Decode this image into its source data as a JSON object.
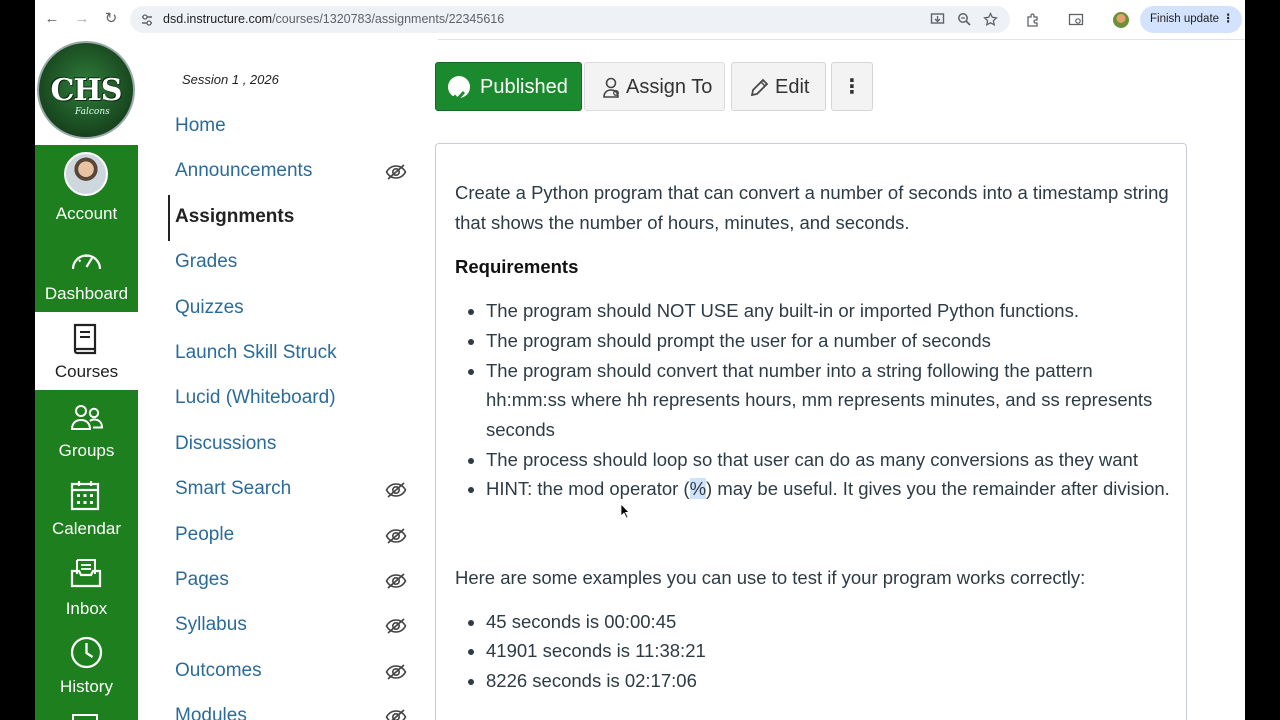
{
  "browser": {
    "url_host": "dsd.instructure.com",
    "url_path": "/courses/1320783/assignments/22345616",
    "finish_update": "Finish update"
  },
  "logo": {
    "text": "CHS",
    "subtext": "Falcons"
  },
  "global_nav": [
    {
      "label": "Account",
      "icon": "avatar"
    },
    {
      "label": "Dashboard",
      "icon": "dashboard-icon"
    },
    {
      "label": "Courses",
      "icon": "courses-icon",
      "active": true
    },
    {
      "label": "Groups",
      "icon": "groups-icon"
    },
    {
      "label": "Calendar",
      "icon": "calendar-icon"
    },
    {
      "label": "Inbox",
      "icon": "inbox-icon"
    },
    {
      "label": "History",
      "icon": "history-icon"
    }
  ],
  "course_nav": {
    "session": "Session 1 , 2026",
    "items": [
      {
        "label": "Home"
      },
      {
        "label": "Announcements",
        "hidden": true
      },
      {
        "label": "Assignments",
        "active": true
      },
      {
        "label": "Grades"
      },
      {
        "label": "Quizzes"
      },
      {
        "label": "Launch Skill Struck"
      },
      {
        "label": "Lucid (Whiteboard)"
      },
      {
        "label": "Discussions"
      },
      {
        "label": "Smart Search",
        "hidden": true
      },
      {
        "label": "People",
        "hidden": true
      },
      {
        "label": "Pages",
        "hidden": true
      },
      {
        "label": "Syllabus",
        "hidden": true
      },
      {
        "label": "Outcomes",
        "hidden": true
      },
      {
        "label": "Modules",
        "hidden": true
      }
    ]
  },
  "actions": {
    "published": "Published",
    "assign_to": "Assign To",
    "edit": "Edit",
    "more": "⋮"
  },
  "description": {
    "intro": "Create a Python program that can convert a number of seconds into a timestamp string that shows the number of hours, minutes, and seconds.",
    "requirements_heading": "Requirements",
    "requirements": [
      "The program should NOT USE any built-in or imported Python functions.",
      "The program should prompt the user for a number of seconds",
      "The program should convert that number into a string following the pattern hh:mm:ss where hh represents hours, mm represents minutes, and ss represents seconds",
      "The process should loop so that user can do as many conversions as they want"
    ],
    "hint_before": "HINT: the mod operator (",
    "hint_highlight": "%",
    "hint_after": ") may be useful. It gives you the remainder after division.",
    "examples_intro": "Here are some examples you can use to test if your program works correctly:",
    "examples": [
      "45 seconds is 00:00:45",
      "41901 seconds is 11:38:21",
      "8226 seconds is 02:17:06"
    ]
  },
  "colors": {
    "canvas_green": "#1d7f1d",
    "link_blue": "#2a6b9a",
    "published_green": "#1b8a2f"
  }
}
